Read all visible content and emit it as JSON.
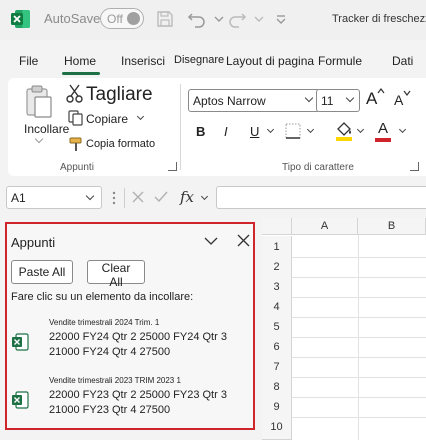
{
  "titlebar": {
    "autosave_label": "AutoSave",
    "toggle_state": "Off",
    "document_title": "Tracker di freschezza"
  },
  "tabs": [
    "File",
    "Home",
    "Inserisci",
    "Disegnare",
    "Layout di pagina",
    "Formule",
    "Dati"
  ],
  "active_tab": "Home",
  "ribbon": {
    "paste_label": "Incollare",
    "cut_label": "Tagliare",
    "copy_label": "Copiare",
    "format_painter_label": "Copia formato",
    "clipboard_group_label": "Appunti",
    "font_name": "Aptos Narrow",
    "font_size": "11",
    "font_group_label": "Tipo di carattere",
    "bold_label": "B",
    "italic_label": "I",
    "underline_label": "U",
    "font_color_label": "A",
    "grow_font_label": "A",
    "shrink_font_label": "A",
    "highlight_color": "#ffd700",
    "font_color": "#d0242c"
  },
  "formula_bar": {
    "name_box": "A1",
    "fx_label": "fx"
  },
  "grid": {
    "columns": [
      "A",
      "B"
    ],
    "rows": [
      "1",
      "2",
      "3",
      "4",
      "5",
      "6",
      "7",
      "8",
      "9",
      "10"
    ]
  },
  "clipboard_pane": {
    "title": "Appunti",
    "paste_all": "Paste All",
    "clear_all": "Clear All",
    "hint": "Fare clic su un elemento da incollare:",
    "items": [
      {
        "title": "Vendite trimestrali 2024 Trim. 1",
        "body": "22000 FY24 Qtr 2 25000 FY24 Qtr 3 21000 FY24 Qtr 4 27500"
      },
      {
        "title": "Vendite trimestrali 2023 TRIM 2023 1",
        "body": "22000 FY23 Qtr 2 25000 FY23 Qtr 3 21000 FY23 Qtr 4 27500"
      }
    ]
  },
  "colors": {
    "excel_green": "#1e7145",
    "pane_border": "#d0242c"
  }
}
